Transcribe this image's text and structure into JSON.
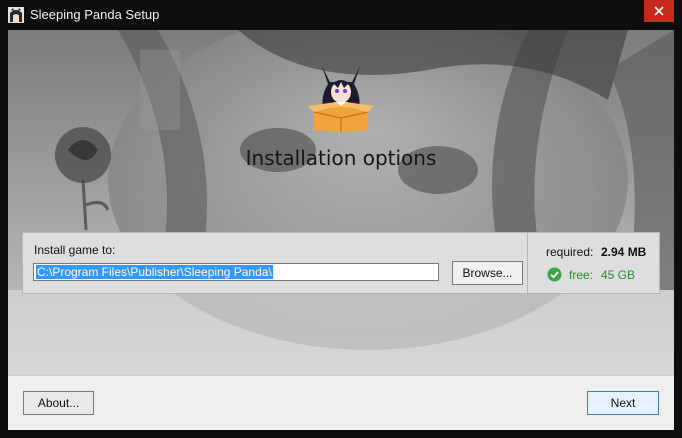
{
  "window": {
    "title": "Sleeping Panda Setup",
    "app_icon": "anime-girl-icon",
    "close_icon": "close-icon",
    "close_color": "#c42b1c"
  },
  "main": {
    "heading": "Installation options",
    "mascot_icon": "mascot-in-box-icon"
  },
  "install": {
    "label": "Install game to:",
    "path": "C:\\Program Files\\Publisher\\Sleeping Panda\\",
    "browse_label": "Browse..."
  },
  "space": {
    "required_label": "required:",
    "required_value": "2.94 MB",
    "free_label": "free:",
    "free_value": "45 GB",
    "free_icon": "check-circle-icon",
    "free_color": "#2e8b2e"
  },
  "footer": {
    "about_label": "About...",
    "next_label": "Next"
  }
}
